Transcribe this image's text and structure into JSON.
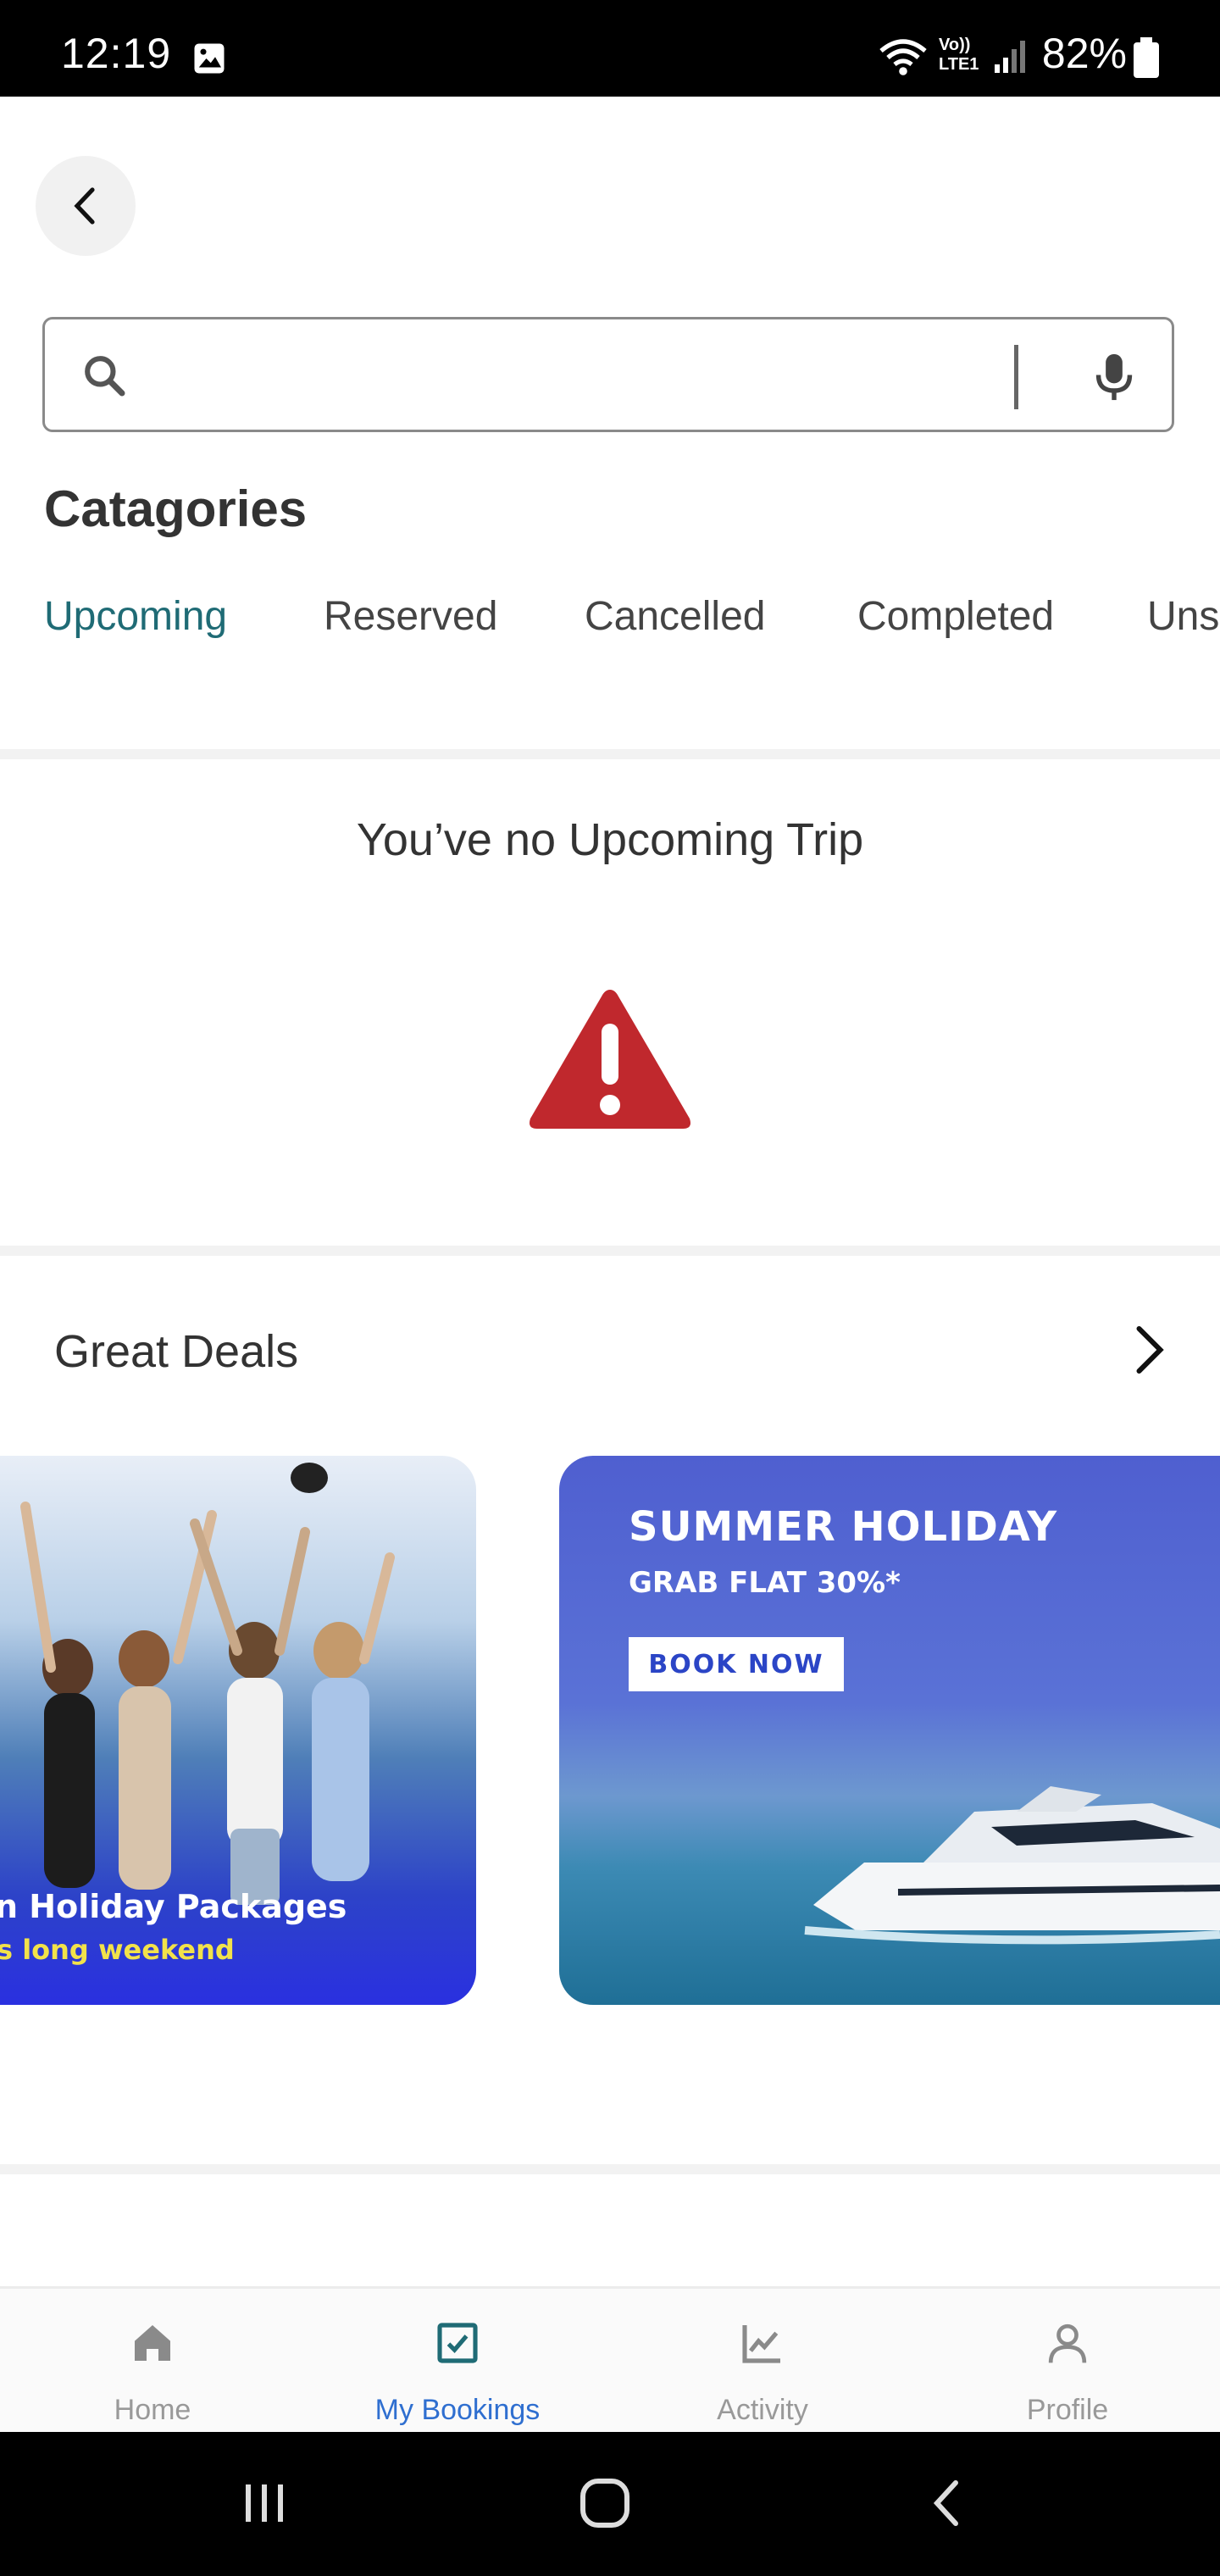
{
  "status_bar": {
    "time": "12:19",
    "network": "Vo)) LTE1",
    "battery": "82%"
  },
  "search": {
    "placeholder": ""
  },
  "categories": {
    "title": "Catagories",
    "tabs": [
      "Upcoming",
      "Reserved",
      "Cancelled",
      "Completed",
      "Uns"
    ],
    "active_tab": "Upcoming"
  },
  "empty_state": {
    "message": "You’ve no Upcoming Trip"
  },
  "deals": {
    "title": "Great Deals",
    "banner_left": {
      "line1": "n Holiday Packages",
      "line2": "s long weekend"
    },
    "banner_right": {
      "line1": "SUMMER HOLIDAY",
      "line2": "GRAB FLAT 30%*",
      "cta": "BOOK NOW"
    }
  },
  "bottom_nav": {
    "items": [
      {
        "label": "Home",
        "icon": "home-icon"
      },
      {
        "label": "My Bookings",
        "icon": "bookings-icon"
      },
      {
        "label": "Activity",
        "icon": "activity-chart-icon"
      },
      {
        "label": "Profile",
        "icon": "profile-icon"
      }
    ],
    "active_index": 1
  },
  "colors": {
    "accent": "#1f6b75",
    "nav_active": "#2f6fd0",
    "warning": "#c0282d",
    "banner_blue": "#4f5fd0"
  }
}
